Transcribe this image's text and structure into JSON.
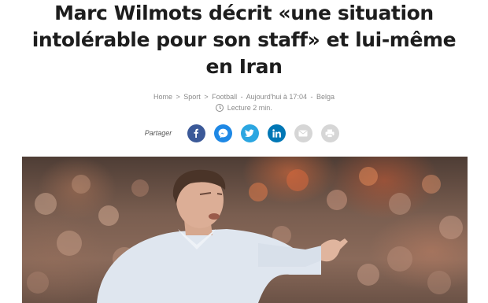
{
  "article": {
    "title": "Marc Wilmots décrit «une situation intolérable pour son staff» et lui-même en Iran"
  },
  "breadcrumb": {
    "home": "Home",
    "section": "Sport",
    "subsection": "Football",
    "date": "Aujourd'hui à 17:04",
    "source": "Belga",
    "separator": ">",
    "dash": "-"
  },
  "reading_time": "Lecture 2 min.",
  "share": {
    "label": "Partager",
    "buttons": [
      {
        "name": "facebook",
        "icon": "facebook-icon",
        "color": "#3b5998"
      },
      {
        "name": "messenger",
        "icon": "messenger-icon",
        "color": "#1e88e5"
      },
      {
        "name": "twitter",
        "icon": "twitter-icon",
        "color": "#2ba6e1"
      },
      {
        "name": "linkedin",
        "icon": "linkedin-icon",
        "color": "#0077b5"
      },
      {
        "name": "email",
        "icon": "envelope-icon",
        "color": "#d6d6d6"
      },
      {
        "name": "print",
        "icon": "printer-icon",
        "color": "#d6d6d6"
      }
    ]
  }
}
